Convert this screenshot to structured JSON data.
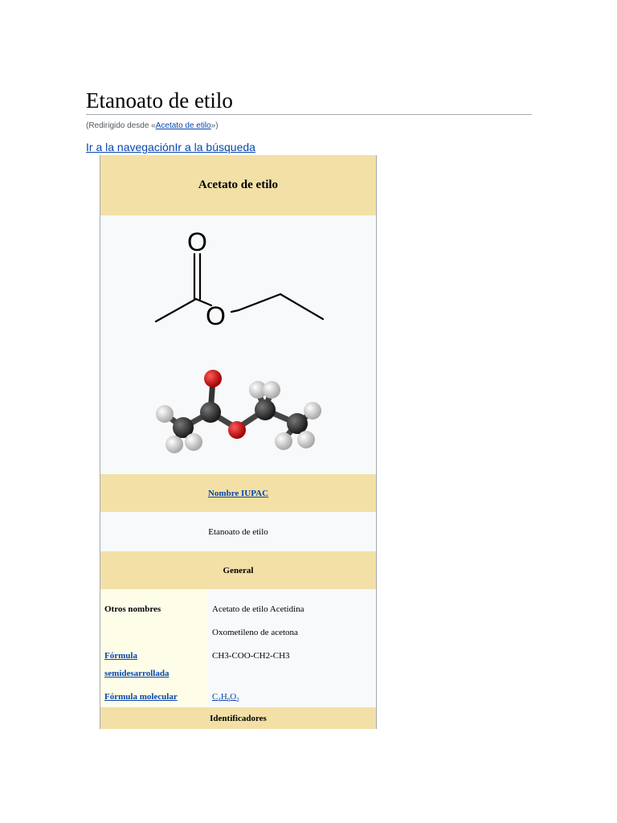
{
  "page": {
    "title": "Etanoato de etilo",
    "redirect_prefix": "(Redirigido desde «",
    "redirect_link": "Acetato de etilo",
    "redirect_suffix": "»)",
    "jump_nav": "Ir a la navegación",
    "jump_search": "Ir a la búsqueda"
  },
  "infobox": {
    "title": "Acetato de etilo",
    "structure_atoms": {
      "carbonyl_oxygen": "O",
      "ester_oxygen": "O"
    },
    "iupac_label": "Nombre IUPAC",
    "iupac_value": "Etanoato de etilo",
    "general_header": "General",
    "rows": [
      {
        "label": "Otros nombres",
        "value": "Acetato de etilo Acetidina"
      },
      {
        "label": "",
        "value": "Oxometileno de acetona"
      },
      {
        "label_line1": "Fórmula",
        "label_line2": "semidesarrollada",
        "value": "CH3-COO-CH2-CH3"
      },
      {
        "label": "Fórmula molecular",
        "value_parts": [
          "C",
          "4",
          "H",
          "8",
          "O",
          "2"
        ]
      }
    ],
    "identifiers_header": "Identificadores"
  },
  "colors": {
    "header_bg": "#f2e0a6",
    "label_bg": "#fefde8",
    "link": "#0645ad",
    "oxygen": "#cc0000",
    "carbon": "#333333",
    "hydrogen": "#e8e8e8"
  }
}
